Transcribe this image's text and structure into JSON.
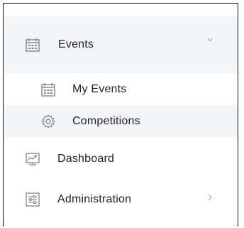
{
  "menu": {
    "events": {
      "label": "Events",
      "icon": "calendar-icon",
      "expanded": true
    },
    "my_events": {
      "label": "My Events",
      "icon": "calendar-icon"
    },
    "competitions": {
      "label": "Competitions",
      "icon": "gear-icon"
    },
    "dashboard": {
      "label": "Dashboard",
      "icon": "chart-board-icon"
    },
    "administration": {
      "label": "Administration",
      "icon": "settings-sliders-icon"
    }
  },
  "colors": {
    "highlight_bg": "#f4f5f8",
    "icon_gray": "#8a8a93",
    "text": "#222222",
    "chevron": "#a8a8b0"
  }
}
